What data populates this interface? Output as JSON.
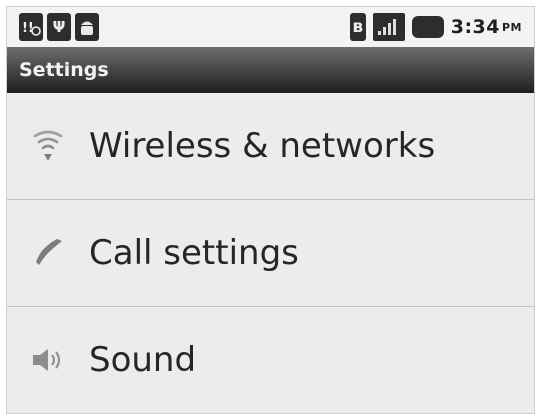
{
  "status_bar": {
    "time": "3:34",
    "ampm": "PM",
    "usb_glyph": "Ψ",
    "bluetooth_glyph": "ʙ"
  },
  "title": "Settings",
  "settings_items": [
    {
      "label": "Wireless & networks",
      "icon": "wifi-icon"
    },
    {
      "label": "Call settings",
      "icon": "phone-icon"
    },
    {
      "label": "Sound",
      "icon": "speaker-icon"
    }
  ],
  "colors": {
    "titlebar": "#1e1e1e",
    "list_background": "#ececec",
    "status_bar": "#f3f3f3"
  }
}
